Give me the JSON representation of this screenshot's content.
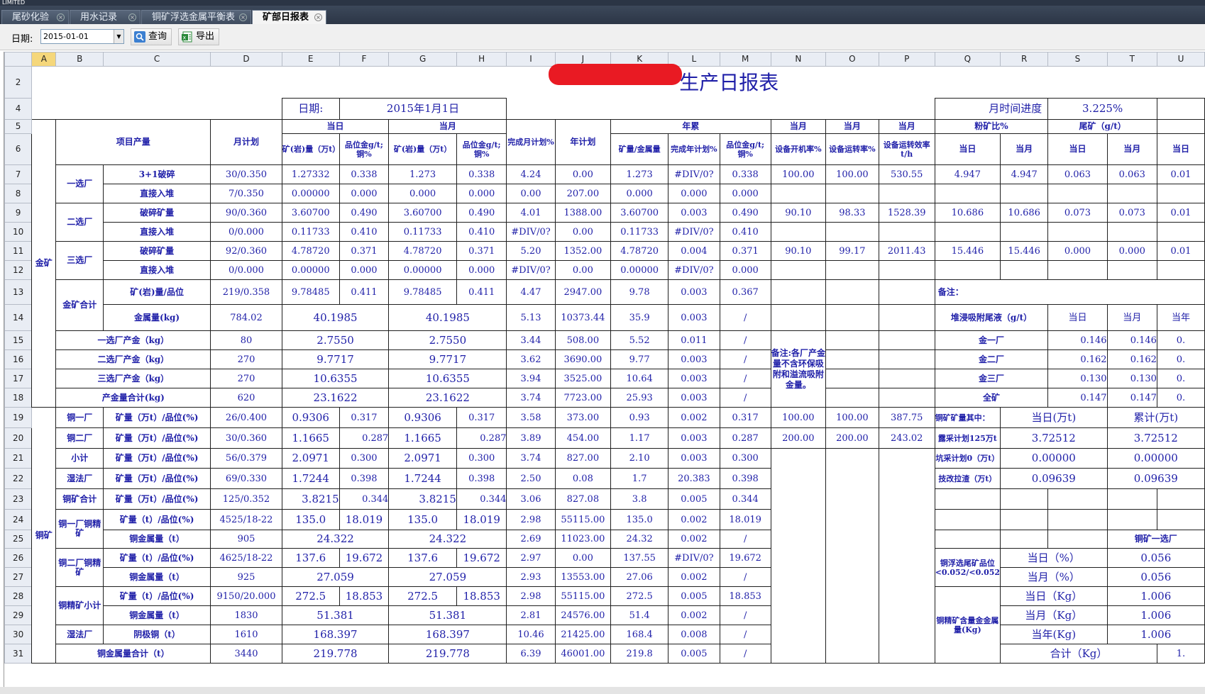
{
  "app": {
    "title": "LIMITED"
  },
  "tabs": [
    {
      "label": "尾砂化验"
    },
    {
      "label": "用水记录"
    },
    {
      "label": "铜矿浮选金属平衡表"
    },
    {
      "label": "矿部日报表"
    }
  ],
  "toolbar": {
    "date_label": "日期:",
    "date_value": "2015-01-01",
    "query_label": "查询",
    "export_label": "导出"
  },
  "colors": {
    "cell_text": "#1f1fa8",
    "header_bg": "#e9edf4",
    "selected_col": "#f5d77b"
  },
  "columns": [
    "A",
    "B",
    "C",
    "D",
    "E",
    "F",
    "G",
    "H",
    "I",
    "J",
    "K",
    "L",
    "M",
    "N",
    "O",
    "P",
    "Q",
    "R",
    "S",
    "T",
    "U"
  ],
  "report": {
    "title": "生产日报表",
    "date_label": "日期:",
    "date_value": "2015年1月1日",
    "progress_label": "月时间进度",
    "progress_value": "3.225%",
    "h_item": "项目产量",
    "h_month_plan": "月计划",
    "h_today": "当日",
    "h_month": "当月",
    "h_complete_month": "完成月计划%",
    "h_year_plan": "年计划",
    "h_year_total": "年累",
    "h_ore_wan": "矿(岩)量（万t）",
    "h_grade": "品位金g/t;铜%",
    "h_ore_metal": "矿量/金属量",
    "h_complete_year": "完成年计划%",
    "h_equip_on": "设备开机率%",
    "h_equip_run": "设备运转率%",
    "h_equip_eff": "设备运转效率t/h",
    "h_fine": "粉矿比%",
    "h_tail": "尾矿（g/t）",
    "h_cur_day": "当日",
    "h_cur_month": "当月",
    "gold": "金矿",
    "copper": "铜矿",
    "r7": {
      "b": "一选厂",
      "c": "3+1破碎",
      "d": "30/0.350",
      "e": "1.27332",
      "f": "0.338",
      "g": "1.273",
      "h": "0.338",
      "i": "4.24",
      "j": "0.00",
      "k": "1.273",
      "l": "#DIV/0?",
      "m": "0.338",
      "n": "100.00",
      "o": "100.00",
      "p": "530.55",
      "q": "4.947",
      "r": "4.947",
      "s": "0.063",
      "t": "0.063",
      "u": "0.01"
    },
    "r8": {
      "c": "直接入堆",
      "d": "7/0.350",
      "e": "0.00000",
      "f": "0.000",
      "g": "0.000",
      "h": "0.000",
      "i": "0.00",
      "j": "207.00",
      "k": "0.000",
      "l": "0.000",
      "m": "0.000"
    },
    "r9": {
      "b": "二选厂",
      "c": "破碎矿量",
      "d": "90/0.360",
      "e": "3.60700",
      "f": "0.490",
      "g": "3.60700",
      "h": "0.490",
      "i": "4.01",
      "j": "1388.00",
      "k": "3.60700",
      "l": "0.003",
      "m": "0.490",
      "n": "90.10",
      "o": "98.33",
      "p": "1528.39",
      "q": "10.686",
      "r": "10.686",
      "s": "0.073",
      "t": "0.073",
      "u": "0.01"
    },
    "r10": {
      "c": "直接入堆",
      "d": "0/0.000",
      "e": "0.11733",
      "f": "0.410",
      "g": "0.11733",
      "h": "0.410",
      "i": "#DIV/0?",
      "j": "0.00",
      "k": "0.11733",
      "l": "#DIV/0?",
      "m": "0.410"
    },
    "r11": {
      "b": "三选厂",
      "c": "破碎矿量",
      "d": "92/0.360",
      "e": "4.78720",
      "f": "0.371",
      "g": "4.78720",
      "h": "0.371",
      "i": "5.20",
      "j": "1352.00",
      "k": "4.78720",
      "l": "0.004",
      "m": "0.371",
      "n": "90.10",
      "o": "99.17",
      "p": "2011.43",
      "q": "15.446",
      "r": "15.446",
      "s": "0.000",
      "t": "0.000",
      "u": "0.01"
    },
    "r12": {
      "c": "直接入堆",
      "d": "0/0.000",
      "e": "0.00000",
      "f": "0.000",
      "g": "0.00000",
      "h": "0.000",
      "i": "#DIV/0?",
      "j": "0.00",
      "k": "0.00000",
      "l": "#DIV/0?",
      "m": "0.000"
    },
    "r13": {
      "b": "金矿合计",
      "c": "矿(岩)量/品位",
      "d": "219/0.358",
      "e": "9.78485",
      "f": "0.411",
      "g": "9.78485",
      "h": "0.411",
      "i": "4.47",
      "j": "2947.00",
      "k": "9.78",
      "l": "0.003",
      "m": "0.367",
      "q": "备注："
    },
    "r14": {
      "c": "金属量(kg)",
      "d": "784.02",
      "e": "40.1985",
      "g": "40.1985",
      "i": "5.13",
      "j": "10373.44",
      "k": "35.9",
      "l": "0.003",
      "m": "/",
      "q": "堆浸吸附尾液（g/t）",
      "s": "当日",
      "t": "当月",
      "u": "当年"
    },
    "r15": {
      "b": "一选厂产金（kg）",
      "d": "80",
      "e": "2.7550",
      "g": "2.7550",
      "i": "3.44",
      "j": "508.00",
      "k": "5.52",
      "l": "0.011",
      "m": "/",
      "n": "备注:各厂产金量不含环保吸附和溢流吸附金量。",
      "q": "金一厂",
      "s": "0.146",
      "t": "0.146",
      "u": "0."
    },
    "r16": {
      "b": "二选厂产金（kg）",
      "d": "270",
      "e": "9.7717",
      "g": "9.7717",
      "i": "3.62",
      "j": "3690.00",
      "k": "9.77",
      "l": "0.003",
      "m": "/",
      "q": "金二厂",
      "s": "0.162",
      "t": "0.162",
      "u": "0."
    },
    "r17": {
      "b": "三选厂产金（kg）",
      "d": "270",
      "e": "10.6355",
      "g": "10.6355",
      "i": "3.94",
      "j": "3525.00",
      "k": "10.64",
      "l": "0.003",
      "m": "/",
      "q": "金三厂",
      "s": "0.130",
      "t": "0.130",
      "u": "0."
    },
    "r18": {
      "b": "产金量合计(kg)",
      "d": "620",
      "e": "23.1622",
      "g": "23.1622",
      "i": "3.74",
      "j": "7723.00",
      "k": "25.93",
      "l": "0.003",
      "m": "/",
      "q": "全矿",
      "s": "0.147",
      "t": "0.147",
      "u": "0."
    },
    "r19": {
      "b": "铜一厂",
      "c": "矿量（万t）/品位(%)",
      "d": "26/0.400",
      "e": "0.9306",
      "f": "0.317",
      "g": "0.9306",
      "h": "0.317",
      "i": "3.58",
      "j": "373.00",
      "k": "0.93",
      "l": "0.002",
      "m": "0.317",
      "n": "100.00",
      "o": "100.00",
      "p": "387.75",
      "q": "铜矿矿量其中：",
      "r": "当日(万t)",
      "t": "累计(万t)"
    },
    "r20": {
      "b": "铜二厂",
      "c": "矿量（万t）/品位(%)",
      "d": "30/0.360",
      "e": "1.1665",
      "f": "0.287",
      "g": "1.1665",
      "h": "0.287",
      "i": "3.89",
      "j": "454.00",
      "k": "1.17",
      "l": "0.003",
      "m": "0.287",
      "n": "200.00",
      "o": "200.00",
      "p": "243.02",
      "q": "露采计划125万t",
      "r": "3.72512",
      "t": "3.72512"
    },
    "r21": {
      "b": "小计",
      "c": "矿量（万t）/品位(%)",
      "d": "56/0.379",
      "e": "2.0971",
      "f": "0.300",
      "g": "2.0971",
      "h": "0.300",
      "i": "3.74",
      "j": "827.00",
      "k": "2.10",
      "l": "0.003",
      "m": "0.300",
      "q": "坑采计划0（万t）",
      "r": "0.00000",
      "t": "0.00000"
    },
    "r22": {
      "b": "湿法厂",
      "c": "矿量（万t）/品位(%)",
      "d": "69/0.330",
      "e": "1.7244",
      "f": "0.398",
      "g": "1.7244",
      "h": "0.398",
      "i": "2.50",
      "j": "0.08",
      "k": "1.7",
      "l": "20.383",
      "m": "0.398",
      "q": "技改拉渣（万t）",
      "r": "0.09639",
      "t": "0.09639"
    },
    "r23": {
      "b": "铜矿合计",
      "c": "矿量（万t）/品位(%)",
      "d": "125/0.352",
      "e": "3.8215",
      "f": "0.344",
      "g": "3.8215",
      "h": "0.344",
      "i": "3.06",
      "j": "827.08",
      "k": "3.8",
      "l": "0.005",
      "m": "0.344"
    },
    "r24": {
      "b": "铜一厂铜精矿",
      "c": "矿量（t）/品位(%)",
      "d": "4525/18-22",
      "e": "135.0",
      "f": "18.019",
      "g": "135.0",
      "h": "18.019",
      "i": "2.98",
      "j": "55115.00",
      "k": "135.0",
      "l": "0.002",
      "m": "18.019"
    },
    "r25": {
      "c": "铜金属量（t）",
      "d": "905",
      "e": "24.322",
      "g": "24.322",
      "i": "2.69",
      "j": "11023.00",
      "k": "24.32",
      "l": "0.002",
      "m": "/",
      "t": "铜矿一选厂"
    },
    "r26": {
      "b": "铜二厂铜精矿",
      "c": "矿量（t）/品位(%)",
      "d": "4625/18-22",
      "e": "137.6",
      "f": "19.672",
      "g": "137.6",
      "h": "19.672",
      "i": "2.97",
      "j": "0.00",
      "k": "137.55",
      "l": "#DIV/0?",
      "m": "19.672",
      "q": "铜浮选尾矿品位<0.052/<0.052",
      "r": "当日（%）",
      "t": "0.056"
    },
    "r27": {
      "c": "铜金属量（t）",
      "d": "925",
      "e": "27.059",
      "g": "27.059",
      "i": "2.93",
      "j": "13553.00",
      "k": "27.06",
      "l": "0.002",
      "m": "/",
      "r": "当月（%）",
      "t": "0.056"
    },
    "r28": {
      "b": "铜精矿小计",
      "c": "矿量（t）/品位(%)",
      "d": "9150/20.000",
      "e": "272.5",
      "f": "18.853",
      "g": "272.5",
      "h": "18.853",
      "i": "2.98",
      "j": "55115.00",
      "k": "272.5",
      "l": "0.005",
      "m": "18.853",
      "q": "铜精矿含量金金属量(Kg)",
      "r": "当日（Kg）",
      "t": "1.006"
    },
    "r29": {
      "c": "铜金属量（t）",
      "d": "1830",
      "e": "51.381",
      "g": "51.381",
      "i": "2.81",
      "j": "24576.00",
      "k": "51.4",
      "l": "0.002",
      "m": "/",
      "r": "当月（Kg）",
      "t": "1.006"
    },
    "r30": {
      "b": "湿法厂",
      "c": "阴极铜（t）",
      "d": "1610",
      "e": "168.397",
      "g": "168.397",
      "i": "10.46",
      "j": "21425.00",
      "k": "168.4",
      "l": "0.008",
      "m": "/",
      "r": "当年(Kg)",
      "t": "1.006"
    },
    "r31": {
      "b": "铜金属量合计（t）",
      "d": "3440",
      "e": "219.778",
      "g": "219.778",
      "i": "6.39",
      "j": "46001.00",
      "k": "219.8",
      "l": "0.005",
      "m": "/",
      "r": "合计（Kg）",
      "u": "1."
    }
  }
}
